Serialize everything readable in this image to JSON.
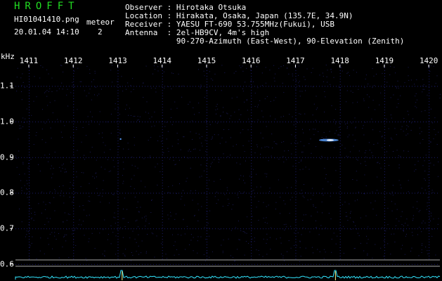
{
  "header": {
    "app_title": "HROFFT",
    "filename": "HI01041410.png",
    "timestamp": "20.01.04 14:10",
    "count_label": "meteor",
    "count_value": "2"
  },
  "station": {
    "observer": "Observer : Hirotaka Otsuka",
    "location": "Location : Hirakata, Osaka, Japan (135.7E, 34.9N)",
    "receiver": "Receiver : YAESU FT-690 53.755MHz(Fukui), USB",
    "antenna": "Antenna  : 2el-HB9CV, 4m's high",
    "antenna_detail": "           90-270-Azimuth (East-West), 90-Elevation (Zenith)"
  },
  "colors": {
    "background": "#000000",
    "grid_dot": "#1c1c6a",
    "noise": "#1a1a55",
    "signal": "#5aa0ff",
    "signal_core": "#ffffff",
    "power_trace": "#33e6ff",
    "power_line": "#a8a8a8",
    "title": "#22dd22"
  },
  "chart_data": {
    "type": "heatmap",
    "xlabel": "",
    "ylabel": "kHz",
    "x_ticks": [
      "1411",
      "1412",
      "1413",
      "1414",
      "1415",
      "1416",
      "1417",
      "1418",
      "1419",
      "1420"
    ],
    "y_ticks": [
      "1.1",
      "1.0",
      "0.9",
      "0.8",
      "0.7",
      "0.6"
    ],
    "xlim": [
      1410.7,
      1420.25
    ],
    "ylim": [
      0.58,
      1.16
    ],
    "events": [
      {
        "time": 1417.75,
        "freq_khz": 0.948,
        "label": "meteor echo (strong)"
      },
      {
        "time": 1413.05,
        "freq_khz": 0.953,
        "label": "meteor echo (weak)"
      }
    ],
    "power_spikes": [
      1413.1,
      1417.9
    ]
  }
}
